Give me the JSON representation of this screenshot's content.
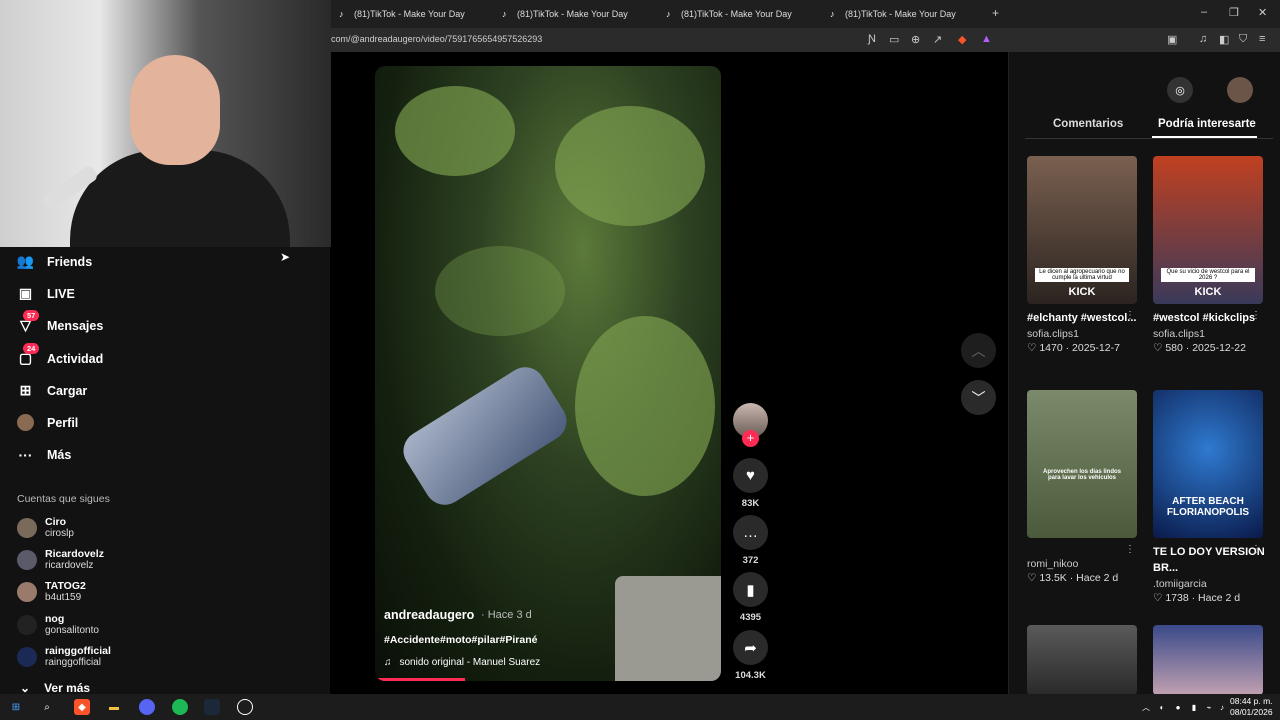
{
  "browser": {
    "tabs": [
      {
        "label": "(81)TikTok - Make Your Day"
      },
      {
        "label": "(81)TikTok - Make Your Day"
      },
      {
        "label": "(81)TikTok - Make Your Day"
      },
      {
        "label": "(81)TikTok - Make Your Day"
      }
    ],
    "url": "com/@andreadaugero/video/7591765654957526293"
  },
  "sidebar": {
    "items": [
      {
        "label": "Friends",
        "icon": "friends-icon"
      },
      {
        "label": "LIVE",
        "icon": "live-icon"
      },
      {
        "label": "Mensajes",
        "icon": "messages-icon",
        "badge": "57"
      },
      {
        "label": "Actividad",
        "icon": "activity-icon",
        "badge": "24"
      },
      {
        "label": "Cargar",
        "icon": "upload-icon"
      },
      {
        "label": "Perfil",
        "icon": "profile-avatar"
      },
      {
        "label": "Más",
        "icon": "more-icon"
      }
    ],
    "following_title": "Cuentas que sigues",
    "following": [
      {
        "name": "Ciro",
        "handle": "ciroslp"
      },
      {
        "name": "Ricardovelz",
        "handle": "ricardovelz"
      },
      {
        "name": "TATOG2",
        "handle": "b4ut159"
      },
      {
        "name": "nog",
        "handle": "gonsalitonto"
      },
      {
        "name": "rainggofficial",
        "handle": "rainggofficial"
      }
    ],
    "see_more": "Ver más"
  },
  "video": {
    "author": "andreadaugero",
    "time": "· Hace 3 d",
    "tags": "#Accidente#moto#pilar#Pirané",
    "music": "sonido original - Manuel Suarez",
    "progress": 0.26
  },
  "actions": {
    "likes": "83K",
    "comments": "372",
    "saves": "4395",
    "shares": "104.3K"
  },
  "right_panel": {
    "tab_comments": "Comentarios",
    "tab_suggested": "Podría interesarte",
    "cards": [
      {
        "title": "#elchanty #westcol...",
        "user": "sofia.clips1",
        "likes": "1470",
        "date": "2025-12-7",
        "caption": "Le dicen al agropecuario que no cumple la ultima virtud",
        "overlay": "KICK"
      },
      {
        "title": "#westcol #kickclips",
        "user": "sofia.clips1",
        "likes": "580",
        "date": "2025-12-22",
        "caption": "Que su vicio de westcol para el 2026 ?",
        "overlay": "KICK"
      },
      {
        "title": "",
        "user": "romi_nikoo",
        "likes": "13.5K",
        "date": "Hace 2 d",
        "caption": "Aprovechen los dias lindos para lavar los vehiculos",
        "overlay": ""
      },
      {
        "title": "TE LO DOY VERSION BR...",
        "user": ".tomiigarcia",
        "likes": "1738",
        "date": "Hace 2 d",
        "caption": "",
        "overlay": "AFTER BEACH FLORIANOPOLIS"
      }
    ]
  },
  "taskbar": {
    "time": "08:44 p. m.",
    "date": "08/01/2026"
  }
}
